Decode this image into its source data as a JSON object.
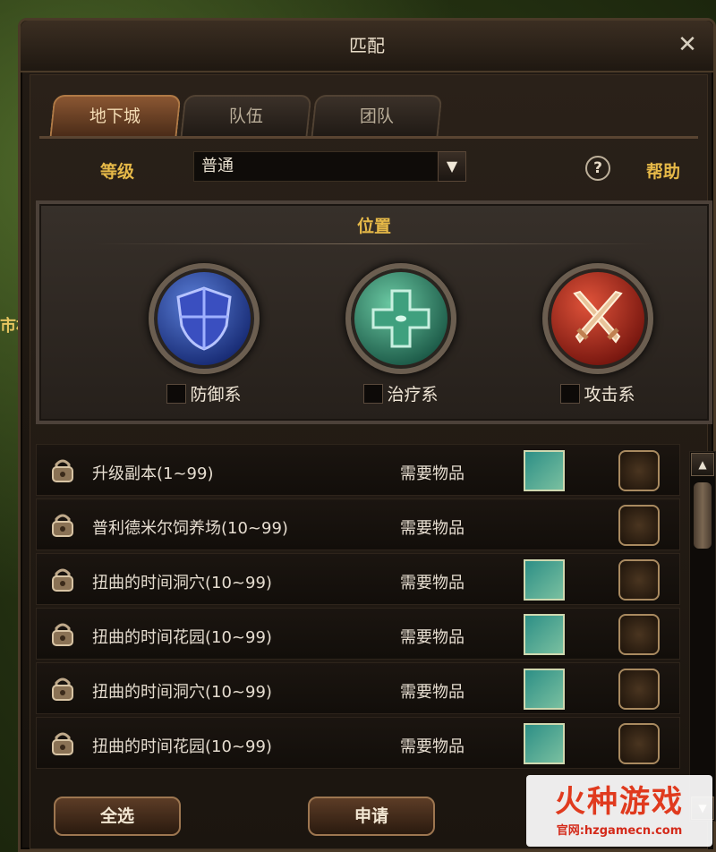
{
  "window": {
    "title": "匹配",
    "close_symbol": "✕"
  },
  "tabs": [
    {
      "label": "地下城",
      "active": true
    },
    {
      "label": "队伍",
      "active": false
    },
    {
      "label": "团队",
      "active": false
    }
  ],
  "level": {
    "label": "等级",
    "value": "普通"
  },
  "help": {
    "icon": "question-icon",
    "symbol": "?",
    "label": "帮助"
  },
  "position": {
    "title": "位置",
    "roles": [
      {
        "label": "防御系",
        "icon": "shield-icon",
        "checked": false
      },
      {
        "label": "治疗系",
        "icon": "cross-icon",
        "checked": false
      },
      {
        "label": "攻击系",
        "icon": "crossed-swords-icon",
        "checked": false
      }
    ]
  },
  "dungeons": [
    {
      "name": "升级副本(1~99)",
      "requirement": "需要物品",
      "has_item": true
    },
    {
      "name": "普利德米尔饲养场(10~99)",
      "requirement": "需要物品",
      "has_item": false
    },
    {
      "name": "扭曲的时间洞穴(10~99)",
      "requirement": "需要物品",
      "has_item": true
    },
    {
      "name": "扭曲的时间花园(10~99)",
      "requirement": "需要物品",
      "has_item": true
    },
    {
      "name": "扭曲的时间洞穴(10~99)",
      "requirement": "需要物品",
      "has_item": true
    },
    {
      "name": "扭曲的时间花园(10~99)",
      "requirement": "需要物品",
      "has_item": true
    }
  ],
  "buttons": {
    "select_all": "全选",
    "apply": "申请"
  },
  "watermark": {
    "title": "火种游戏",
    "url": "官网:hzgamecn.com"
  },
  "edge_text": "市村",
  "colors": {
    "accent_gold": "#e6b948",
    "tab_active": "#8a5632"
  }
}
